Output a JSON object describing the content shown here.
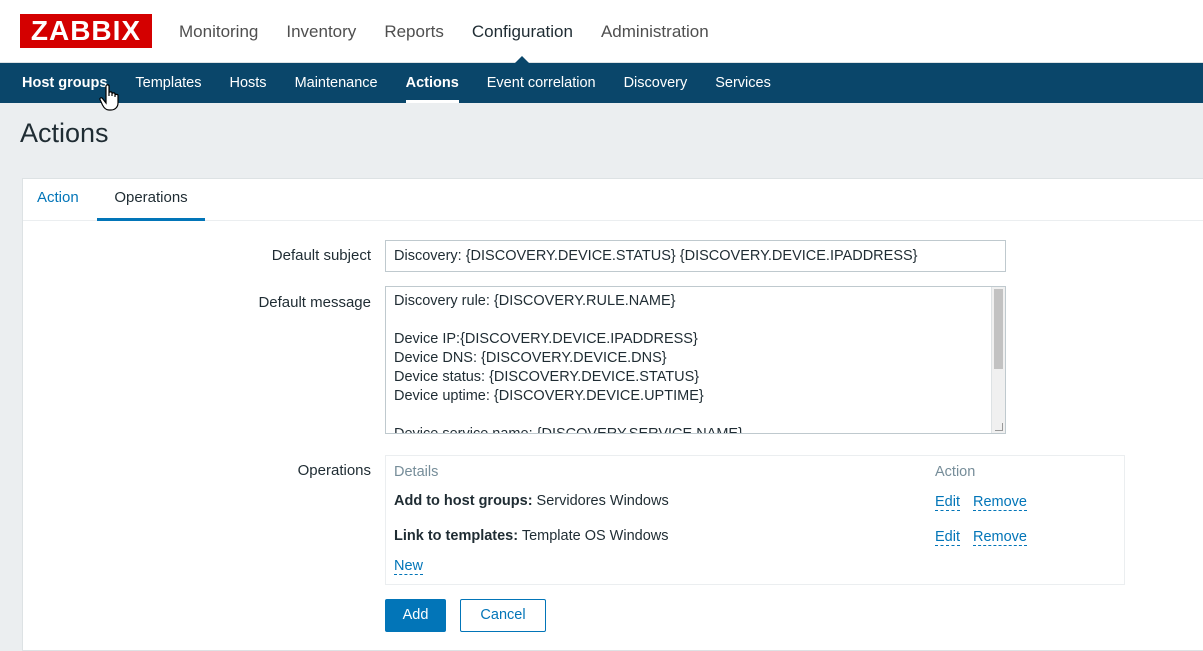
{
  "logo": "ZABBIX",
  "main_menu": [
    {
      "label": "Monitoring"
    },
    {
      "label": "Inventory"
    },
    {
      "label": "Reports"
    },
    {
      "label": "Configuration"
    },
    {
      "label": "Administration"
    }
  ],
  "sub_menu": [
    {
      "label": "Host groups"
    },
    {
      "label": "Templates"
    },
    {
      "label": "Hosts"
    },
    {
      "label": "Maintenance"
    },
    {
      "label": "Actions"
    },
    {
      "label": "Event correlation"
    },
    {
      "label": "Discovery"
    },
    {
      "label": "Services"
    }
  ],
  "page_title": "Actions",
  "tabs": [
    {
      "label": "Action"
    },
    {
      "label": "Operations"
    }
  ],
  "form": {
    "default_subject_label": "Default subject",
    "default_subject_value": "Discovery: {DISCOVERY.DEVICE.STATUS} {DISCOVERY.DEVICE.IPADDRESS}",
    "default_message_label": "Default message",
    "default_message_value": "Discovery rule: {DISCOVERY.RULE.NAME}\n\nDevice IP:{DISCOVERY.DEVICE.IPADDRESS}\nDevice DNS: {DISCOVERY.DEVICE.DNS}\nDevice status: {DISCOVERY.DEVICE.STATUS}\nDevice uptime: {DISCOVERY.DEVICE.UPTIME}\n\nDevice service name: {DISCOVERY.SERVICE.NAME}",
    "operations_label": "Operations"
  },
  "operations": {
    "col_details": "Details",
    "col_action": "Action",
    "rows": [
      {
        "key": "Add to host groups:",
        "value": " Servidores Windows",
        "edit": "Edit",
        "remove": "Remove"
      },
      {
        "key": "Link to templates:",
        "value": " Template OS Windows",
        "edit": "Edit",
        "remove": "Remove"
      }
    ],
    "new_label": "New"
  },
  "buttons": {
    "add": "Add",
    "cancel": "Cancel"
  },
  "colors": {
    "brand_red": "#d40000",
    "nav_blue": "#0a466a",
    "link_blue": "#0275b8"
  }
}
